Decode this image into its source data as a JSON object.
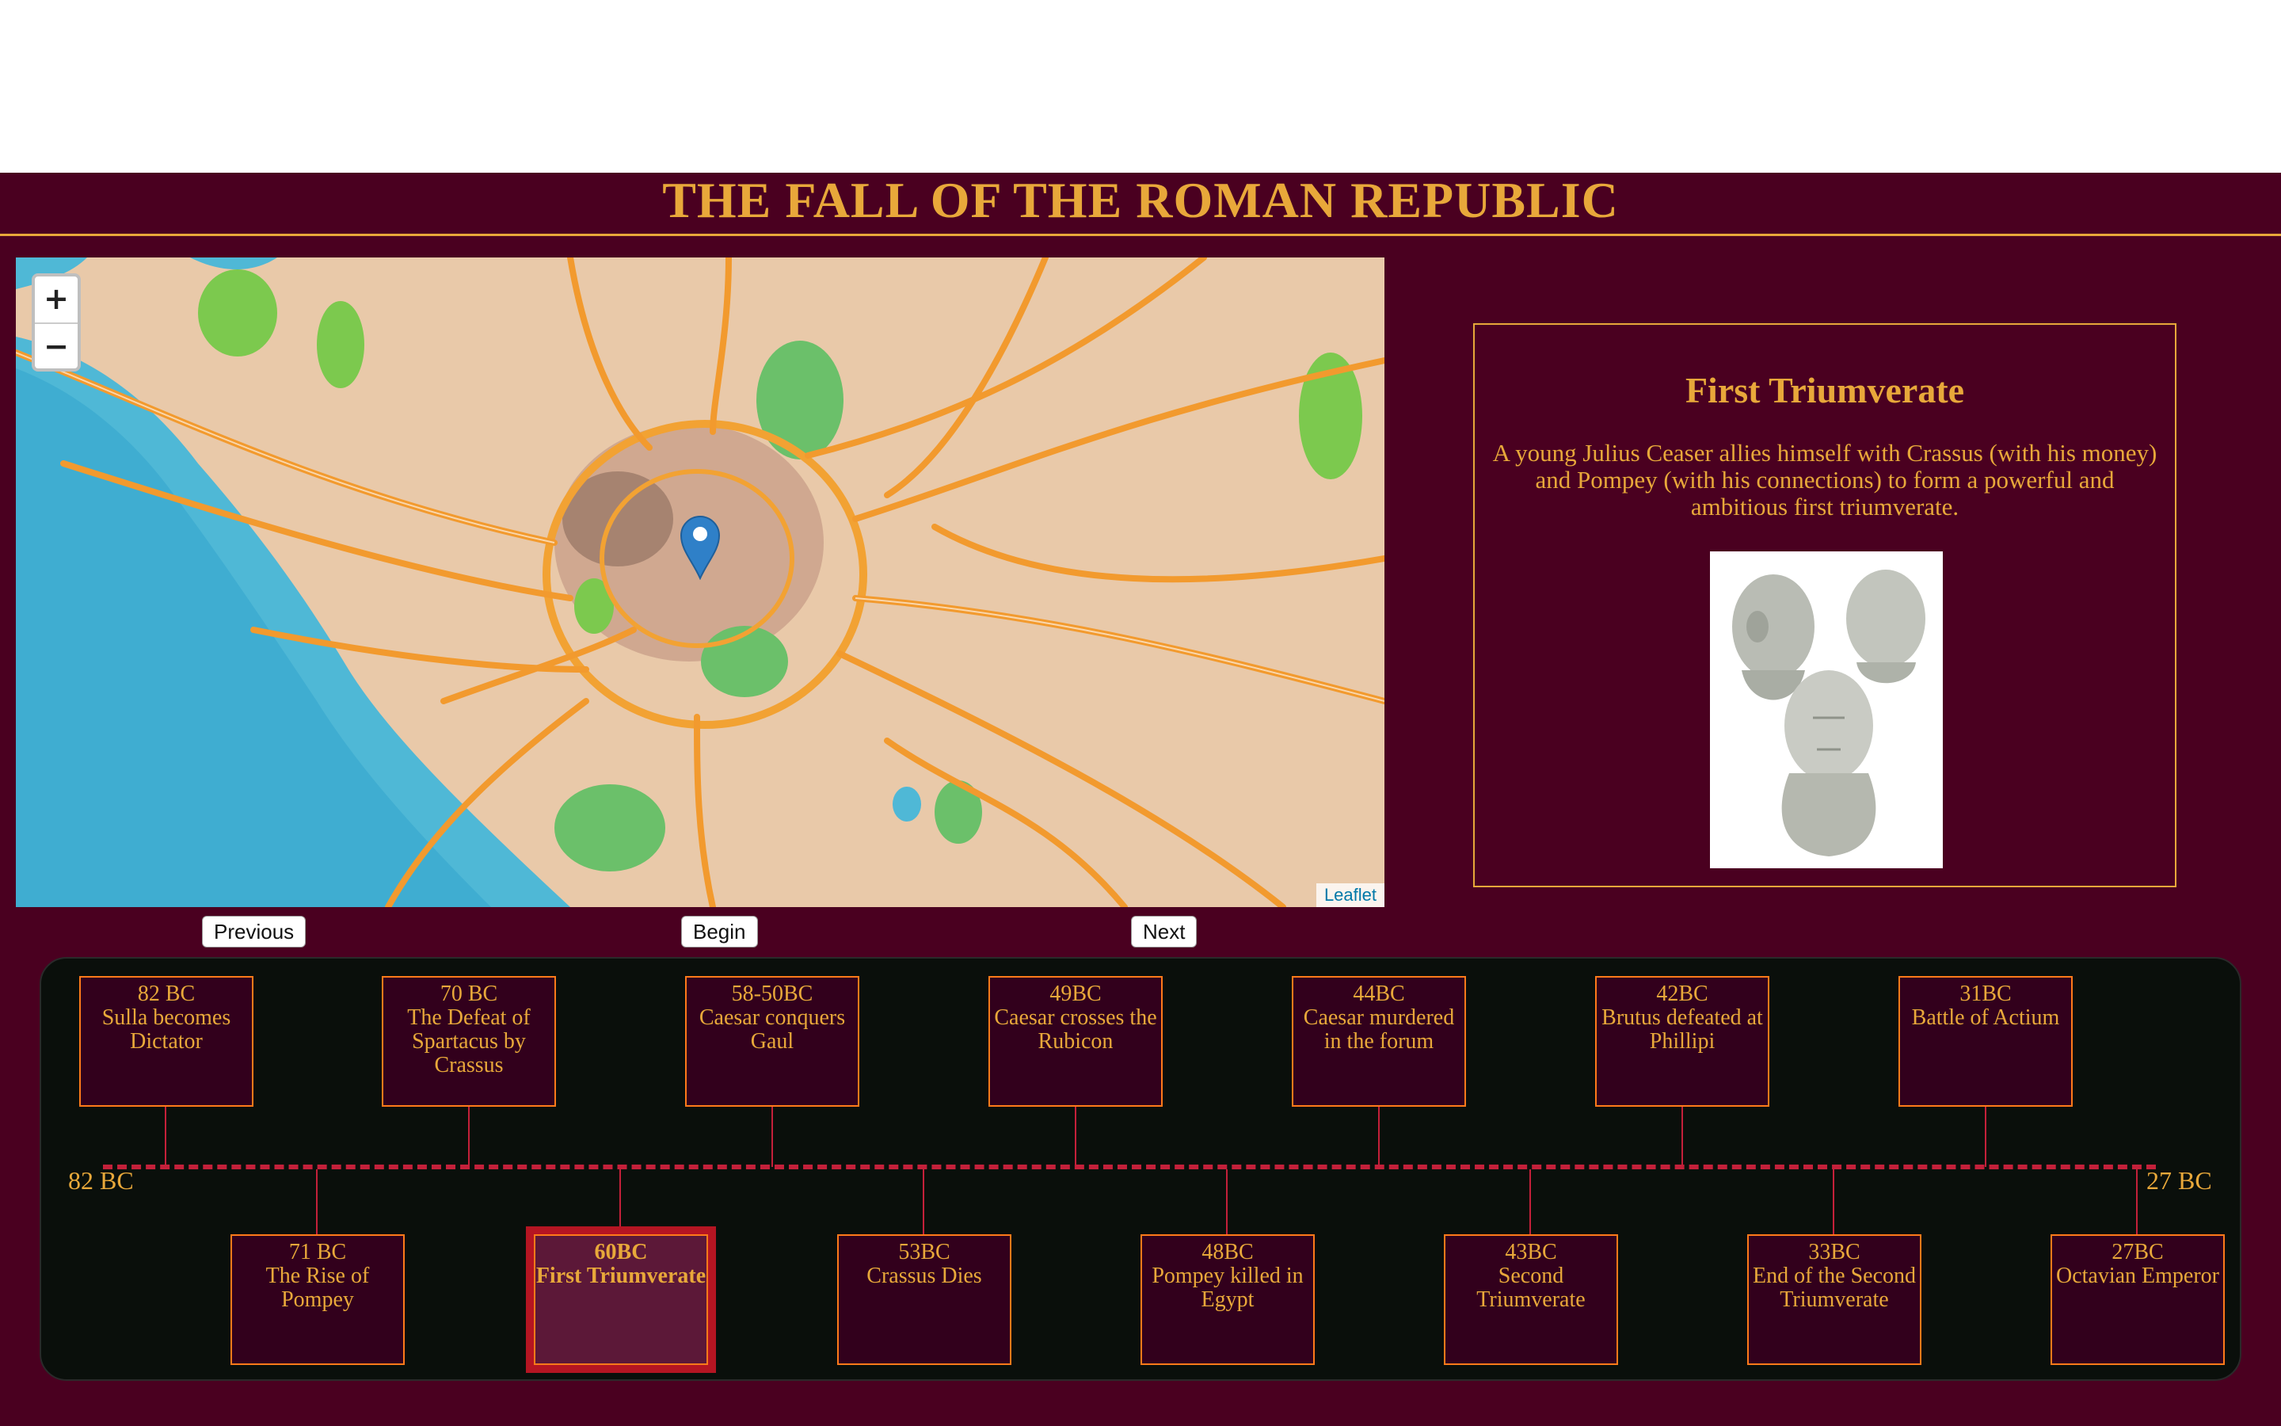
{
  "header": {
    "title": "THE FALL OF THE ROMAN REPUBLIC"
  },
  "map": {
    "zoom_in": "+",
    "zoom_out": "−",
    "attribution": "Leaflet"
  },
  "info": {
    "title": "First Triumverate",
    "description": "A young Julius Ceaser allies himself with Crassus (with his money) and Pompey (with his connections) to form a powerful and ambitious first triumverate."
  },
  "nav": {
    "previous": "Previous",
    "begin": "Begin",
    "next": "Next"
  },
  "timeline": {
    "start_label": "82 BC",
    "end_label": "27 BC",
    "top_events": [
      {
        "year": "82 BC",
        "title": "Sulla becomes Dictator"
      },
      {
        "year": "70 BC",
        "title": "The Defeat of Spartacus by Crassus"
      },
      {
        "year": "58-50BC",
        "title": "Caesar conquers Gaul"
      },
      {
        "year": "49BC",
        "title": "Caesar crosses the Rubicon"
      },
      {
        "year": "44BC",
        "title": "Caesar murdered in the forum"
      },
      {
        "year": "42BC",
        "title": "Brutus defeated at Phillipi"
      },
      {
        "year": "31BC",
        "title": "Battle of Actium"
      }
    ],
    "bottom_events": [
      {
        "year": "71 BC",
        "title": "The Rise of Pompey"
      },
      {
        "year": "60BC",
        "title": "First Triumverate",
        "active": true
      },
      {
        "year": "53BC",
        "title": "Crassus Dies"
      },
      {
        "year": "48BC",
        "title": "Pompey killed in Egypt"
      },
      {
        "year": "43BC",
        "title": "Second Triumverate"
      },
      {
        "year": "33BC",
        "title": "End of the Second Triumverate"
      },
      {
        "year": "27BC",
        "title": "Octavian Emperor"
      }
    ]
  },
  "colors": {
    "gold": "#e8a83a",
    "maroon": "#4a0020",
    "accent_red": "#c4203a",
    "card_border": "#ff7a1a"
  }
}
